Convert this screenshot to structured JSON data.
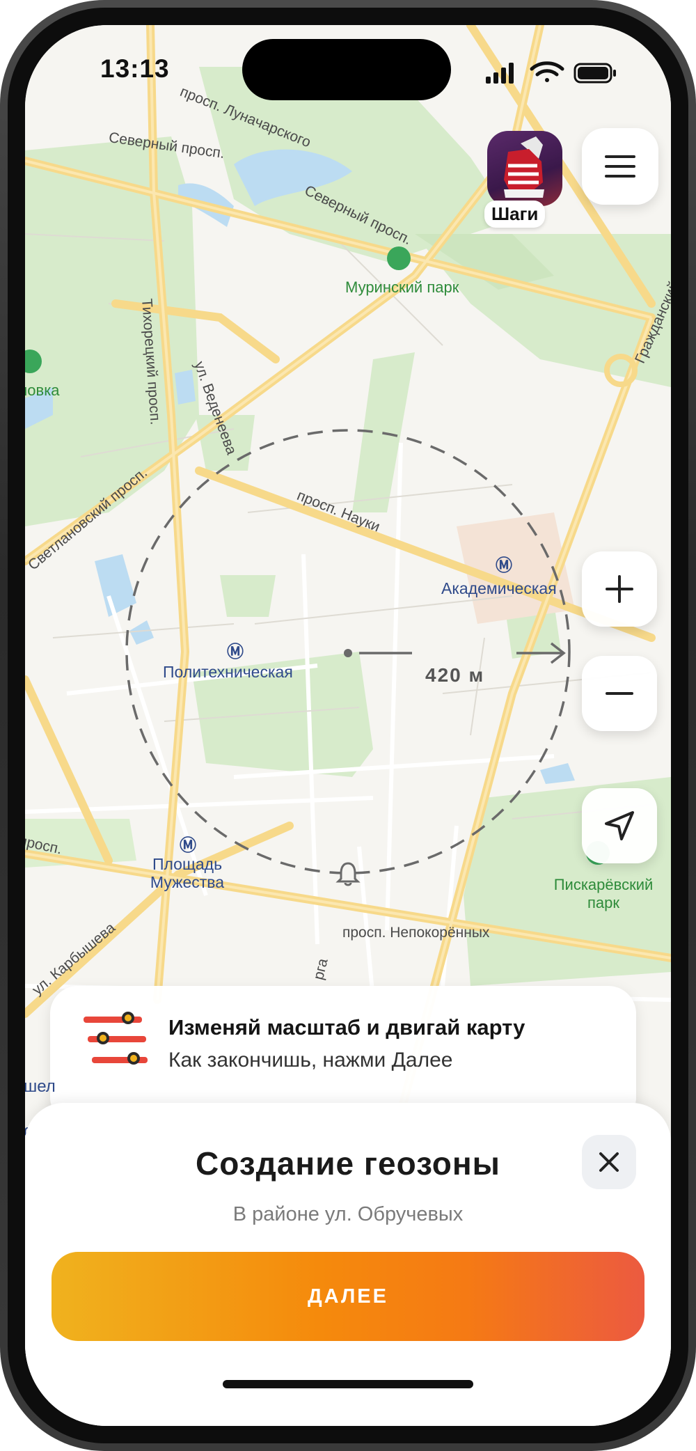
{
  "status_bar": {
    "time": "13:13"
  },
  "header": {
    "avatar_label": "Шаги"
  },
  "map": {
    "geofence_radius": "420 м",
    "streets": [
      "просп. Луначарского",
      "Северный просп.",
      "Северный просп.",
      "Гражданский",
      "Тихорецкий просп.",
      "ул. Веденеева",
      "Светлановский просп.",
      "просп. Науки",
      "просп.",
      "ул. Карбышева",
      "просп. Непокорённых",
      "рга"
    ],
    "parks": [
      "Муринский парк",
      "Сосновка",
      "Пискарёвский парк"
    ],
    "metro": [
      "Академическая",
      "Политехническая",
      "Площадь Мужества"
    ],
    "partial": [
      "шел",
      "с"
    ]
  },
  "hint": {
    "title": "Изменяй масштаб и двигай карту",
    "subtitle": "Как закончишь, нажми Далее"
  },
  "sheet": {
    "title": "Создание геозоны",
    "subtitle": "В районе ул. Обручевых",
    "next_label": "ДАЛЕЕ"
  },
  "colors": {
    "accent_start": "#f0b21e",
    "accent_end": "#ec5a40",
    "park": "#d7ebcb",
    "road_major": "#f7d98a",
    "metro": "#2f4a8a"
  },
  "icons": [
    "menu-icon",
    "plus-icon",
    "minus-icon",
    "location-arrow-icon",
    "bell-icon",
    "close-icon",
    "slider-icon",
    "park-pin-icon",
    "metro-icon",
    "signal-icon",
    "wifi-icon",
    "battery-icon"
  ]
}
